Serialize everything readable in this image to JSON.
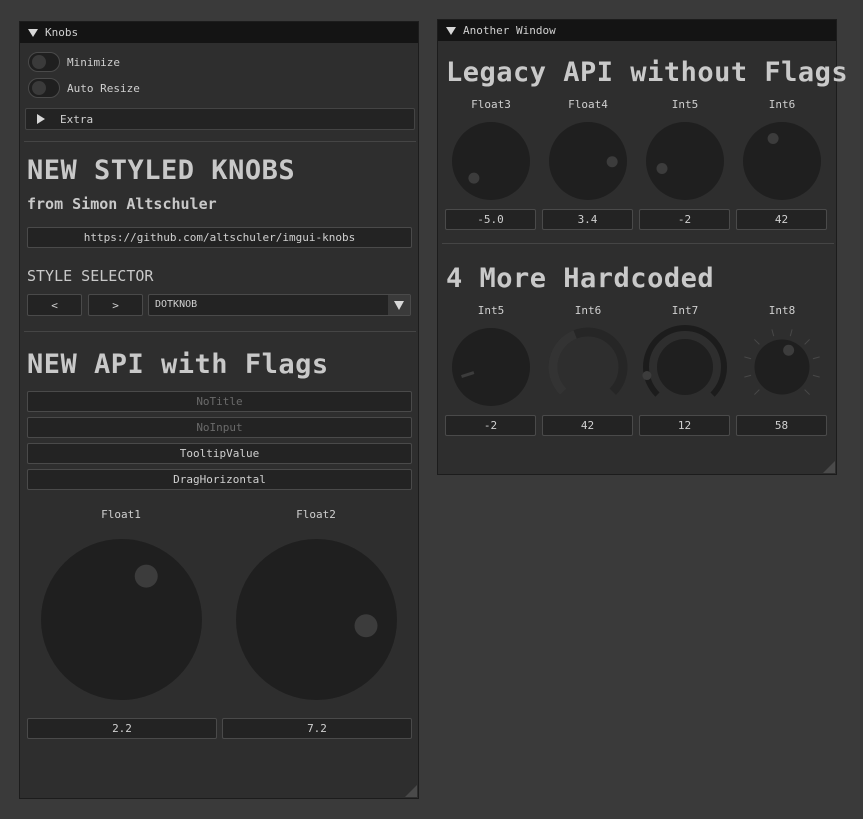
{
  "knobs_window": {
    "title": "Knobs",
    "minimize_label": "Minimize",
    "auto_resize_label": "Auto Resize",
    "extra_label": "Extra",
    "heading": "NEW STYLED KNOBS",
    "subheading": "from Simon Altschuler",
    "url_button": "https://github.com/altschuler/imgui-knobs",
    "style_selector_label": "STYLE SELECTOR",
    "prev_label": "<",
    "next_label": ">",
    "style_value": "DOTKNOB",
    "api_heading": "NEW API with Flags",
    "flag_buttons": [
      "NoTitle",
      "NoInput",
      "TooltipValue",
      "DragHorizontal"
    ],
    "knobs": [
      {
        "title": "Float1",
        "value": "2.2",
        "fraction": 0.61
      },
      {
        "title": "Float2",
        "value": "7.2",
        "fraction": 0.86
      }
    ]
  },
  "another_window": {
    "title": "Another Window",
    "heading": "Legacy API without Flags",
    "knobs": [
      {
        "title": "Float3",
        "value": "-5.0",
        "fraction": 0.0
      },
      {
        "title": "Float4",
        "value": "3.4",
        "fraction": 0.84
      },
      {
        "title": "Int5",
        "value": "-2",
        "fraction": 0.1
      },
      {
        "title": "Int6",
        "value": "42",
        "fraction": 0.42
      }
    ],
    "heading2": "4 More Hardcoded",
    "knobs2": [
      {
        "title": "Int5",
        "value": "-2",
        "fraction": 0.1,
        "style": "tick"
      },
      {
        "title": "Int6",
        "value": "42",
        "fraction": 0.42,
        "style": "arc"
      },
      {
        "title": "Int7",
        "value": "12",
        "fraction": 0.12,
        "style": "wiper-dot"
      },
      {
        "title": "Int8",
        "value": "58",
        "fraction": 0.58,
        "style": "stepped"
      }
    ]
  },
  "colors": {
    "background": "#3a3a3a",
    "window": "#2e2e2e",
    "titlebar": "#141414",
    "knob": "#1f1f1f",
    "dot": "#3c3c3c"
  }
}
